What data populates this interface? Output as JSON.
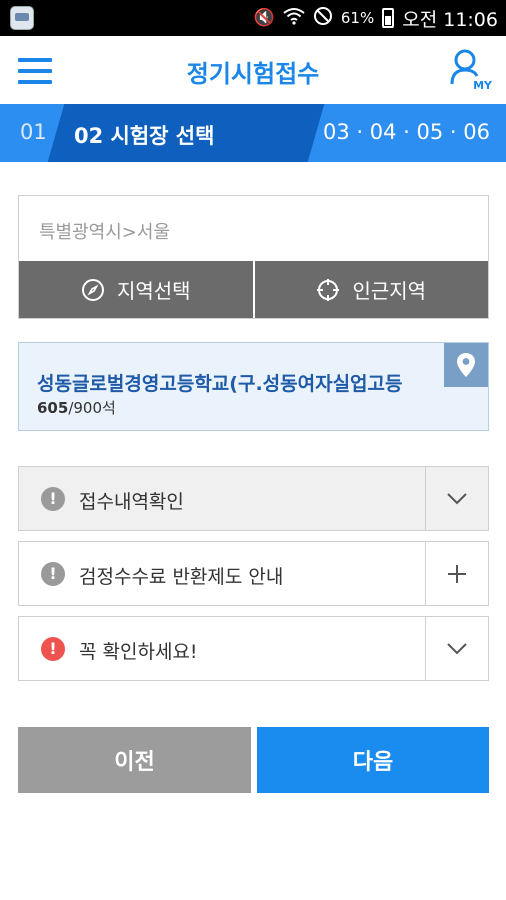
{
  "status_bar": {
    "battery": "61%",
    "time": "오전 11:06",
    "icons": [
      "mute-icon",
      "wifi-icon",
      "do-not-disturb-icon",
      "battery-icon"
    ]
  },
  "header": {
    "title": "정기시험접수",
    "my_label": "MY"
  },
  "steps": {
    "first": "01",
    "active": "02  시험장 선택",
    "rest": "03 · 04 · 05 · 06"
  },
  "region": {
    "value": "특별광역시>서울",
    "select_label": "지역선택",
    "nearby_label": "인근지역"
  },
  "school": {
    "name": "성동글로벌경영고등학교(구.성동여자실업고등",
    "seats_taken": "605",
    "seats_total": "/900석"
  },
  "accordions": [
    {
      "label": "접수내역확인",
      "toggle": "chevron-down"
    },
    {
      "label": "검정수수료 반환제도 안내",
      "toggle": "plus"
    },
    {
      "label": "꼭 확인하세요!",
      "toggle": "chevron-down"
    }
  ],
  "buttons": {
    "prev": "이전",
    "next": "다음"
  },
  "colors": {
    "primary": "#1a86e8",
    "step_active": "#0f5fbf",
    "alert_red": "#ef5350"
  }
}
